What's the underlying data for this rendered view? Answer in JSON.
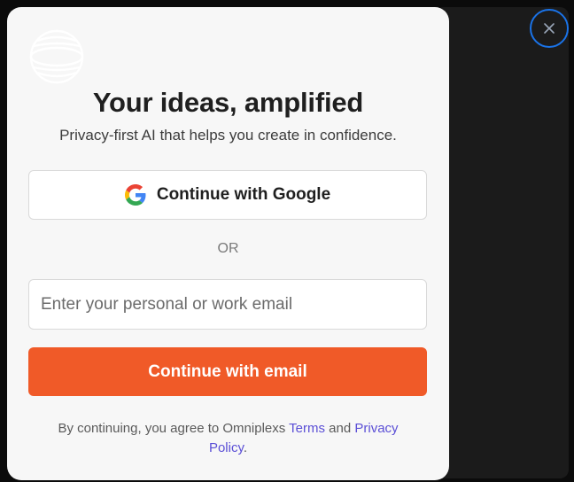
{
  "modal": {
    "title": "Your ideas, amplified",
    "subtitle": "Privacy-first AI that helps you create in confidence.",
    "google_button_label": "Continue with Google",
    "divider_text": "OR",
    "email_input": {
      "value": "",
      "placeholder": "Enter your personal or work email"
    },
    "email_button_label": "Continue with email",
    "legal": {
      "prefix": "By continuing, you agree to Omniplexs ",
      "terms_link": "Terms",
      "and_text": " and ",
      "privacy_link": "Privacy Policy",
      "suffix": "."
    }
  },
  "icons": {
    "logo": "globe-logo-icon",
    "close": "close-icon",
    "google": "google-icon"
  },
  "colors": {
    "accent": "#f05a28",
    "link": "#5b4fd6",
    "focus_ring": "#1a73e8",
    "modal_background": "#f7f7f7"
  }
}
